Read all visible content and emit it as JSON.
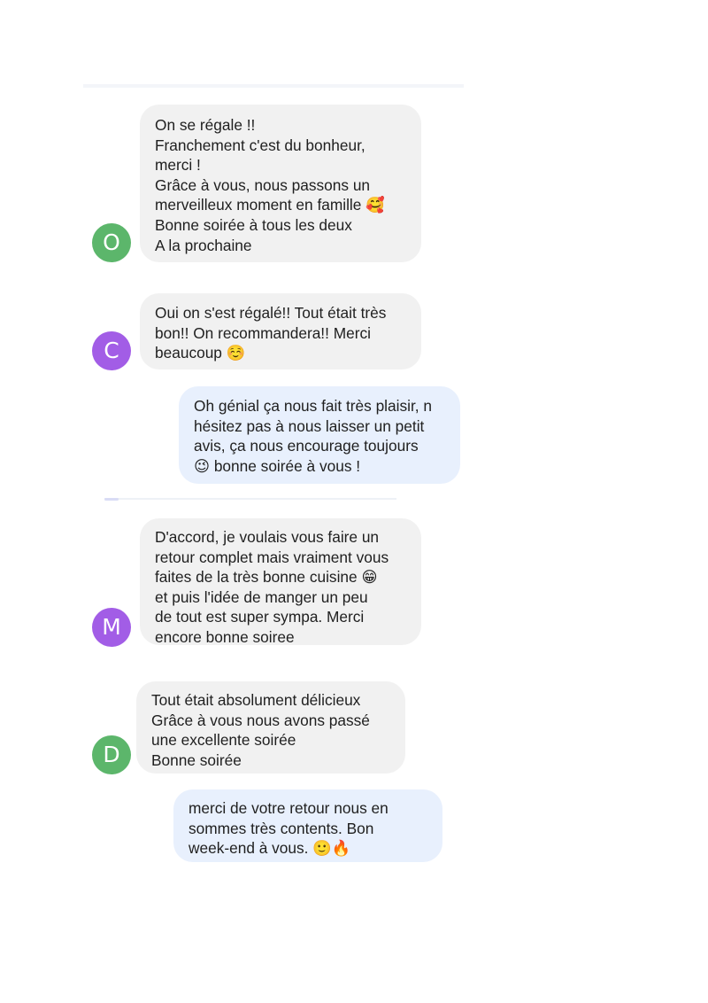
{
  "colors": {
    "incoming_bubble": "#f1f1f1",
    "outgoing_bubble": "#e8f0fd",
    "avatar_o": "#5cb66b",
    "avatar_c": "#a25de6",
    "avatar_m": "#a25de6",
    "avatar_d": "#5cb66b"
  },
  "conversation": {
    "messages": [
      {
        "direction": "incoming",
        "avatar_letter": "O",
        "text": "On se régale !!\nFranchement c'est du bonheur,\nmerci !\nGrâce à vous, nous passons un\nmerveilleux moment en famille 🥰\nBonne soirée à tous les deux\nA la prochaine"
      },
      {
        "direction": "incoming",
        "avatar_letter": "C",
        "text": "Oui on s'est régalé!! Tout était très\nbon!! On recommandera!! Merci\nbeaucoup ☺️"
      },
      {
        "direction": "outgoing",
        "text": "Oh génial ça nous fait très plaisir, n\nhésitez pas à nous laisser un petit\navis, ça nous encourage toujours\n😉 bonne soirée à vous !"
      },
      {
        "direction": "incoming",
        "avatar_letter": "M",
        "text": "D'accord, je voulais vous faire un\nretour complet mais vraiment vous\nfaites de la très bonne cuisine 😁\net puis l'idée de manger un peu\nde tout est super sympa. Merci\nencore bonne soiree"
      },
      {
        "direction": "incoming",
        "avatar_letter": "D",
        "text": "Tout était absolument délicieux\nGrâce à vous nous avons passé\nune excellente soirée\nBonne soirée"
      },
      {
        "direction": "outgoing",
        "text": "merci de votre retour nous en\nsommes très contents. Bon\nweek-end à vous. 🙂🔥"
      }
    ]
  }
}
